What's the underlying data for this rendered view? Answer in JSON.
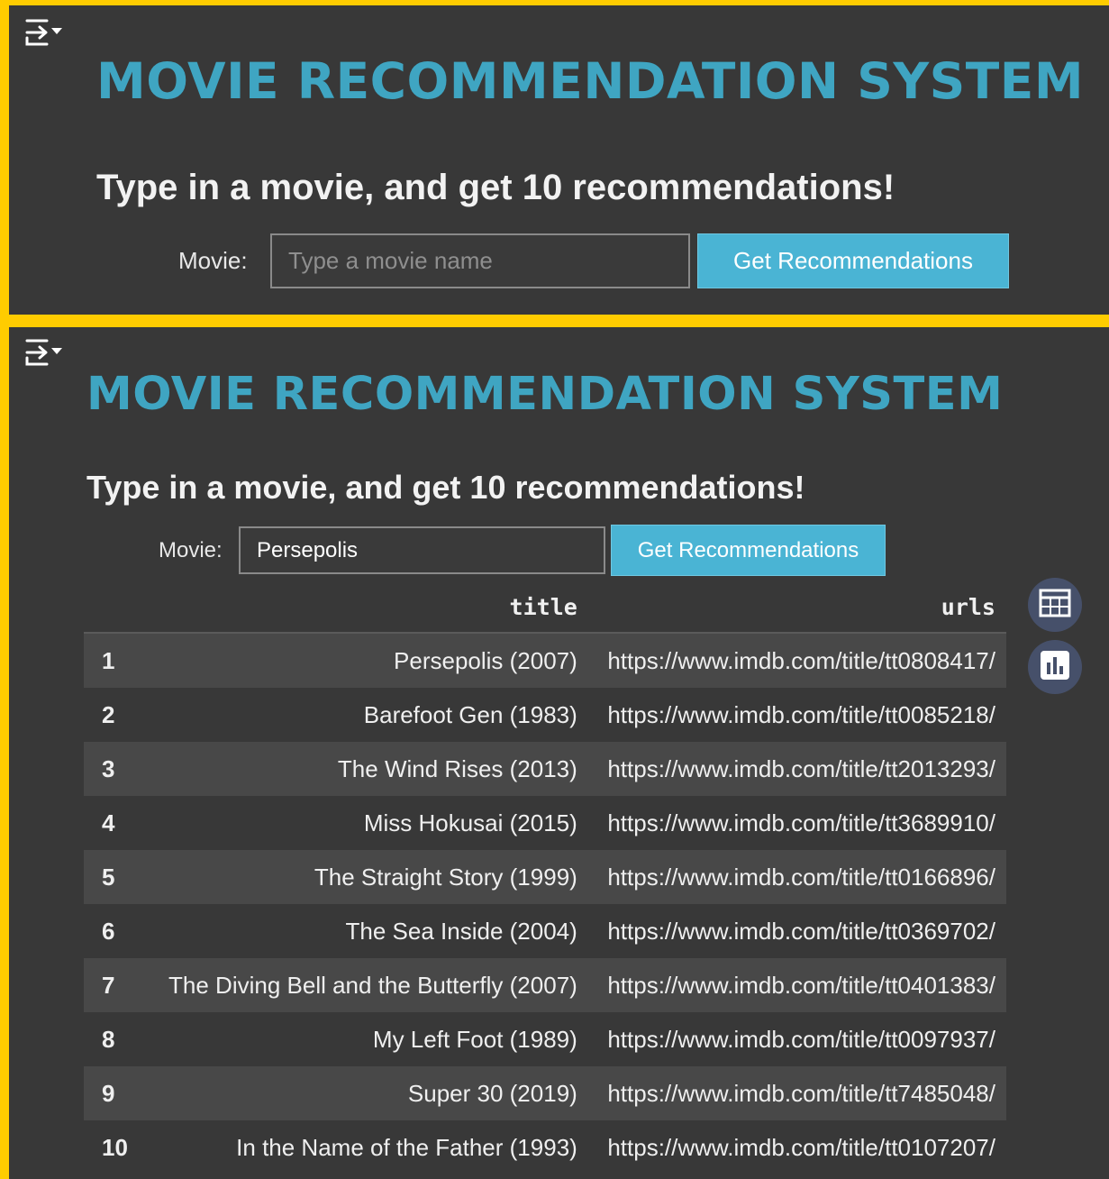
{
  "header": {
    "title": "MOVIE RECOMMENDATION SYSTEM",
    "subtitle": "Type in a movie, and get 10 recommendations!"
  },
  "form": {
    "label": "Movie:",
    "placeholder": "Type a movie name",
    "button_label": "Get Recommendations"
  },
  "result_form": {
    "label": "Movie:",
    "value": "Persepolis",
    "button_label": "Get Recommendations"
  },
  "table": {
    "columns": [
      "",
      "title",
      "urls"
    ],
    "rows": [
      {
        "idx": "1",
        "title": "Persepolis (2007)",
        "url": "https://www.imdb.com/title/tt0808417/"
      },
      {
        "idx": "2",
        "title": "Barefoot Gen (1983)",
        "url": "https://www.imdb.com/title/tt0085218/"
      },
      {
        "idx": "3",
        "title": "The Wind Rises (2013)",
        "url": "https://www.imdb.com/title/tt2013293/"
      },
      {
        "idx": "4",
        "title": "Miss Hokusai (2015)",
        "url": "https://www.imdb.com/title/tt3689910/"
      },
      {
        "idx": "5",
        "title": "The Straight Story (1999)",
        "url": "https://www.imdb.com/title/tt0166896/"
      },
      {
        "idx": "6",
        "title": "The Sea Inside (2004)",
        "url": "https://www.imdb.com/title/tt0369702/"
      },
      {
        "idx": "7",
        "title": "The Diving Bell and the Butterfly (2007)",
        "url": "https://www.imdb.com/title/tt0401383/"
      },
      {
        "idx": "8",
        "title": "My Left Foot (1989)",
        "url": "https://www.imdb.com/title/tt0097937/"
      },
      {
        "idx": "9",
        "title": "Super 30 (2019)",
        "url": "https://www.imdb.com/title/tt7485048/"
      },
      {
        "idx": "10",
        "title": "In the Name of the Father (1993)",
        "url": "https://www.imdb.com/title/tt0107207/"
      }
    ]
  },
  "icons": {
    "collapse": "collapse-sidebar-icon",
    "table_view": "table-icon",
    "chart_view": "bar-chart-icon"
  },
  "colors": {
    "frame": "#ffcc00",
    "background": "#383838",
    "title": "#3fa5c2",
    "button": "#4ab4d4",
    "side_button": "#46506a"
  }
}
